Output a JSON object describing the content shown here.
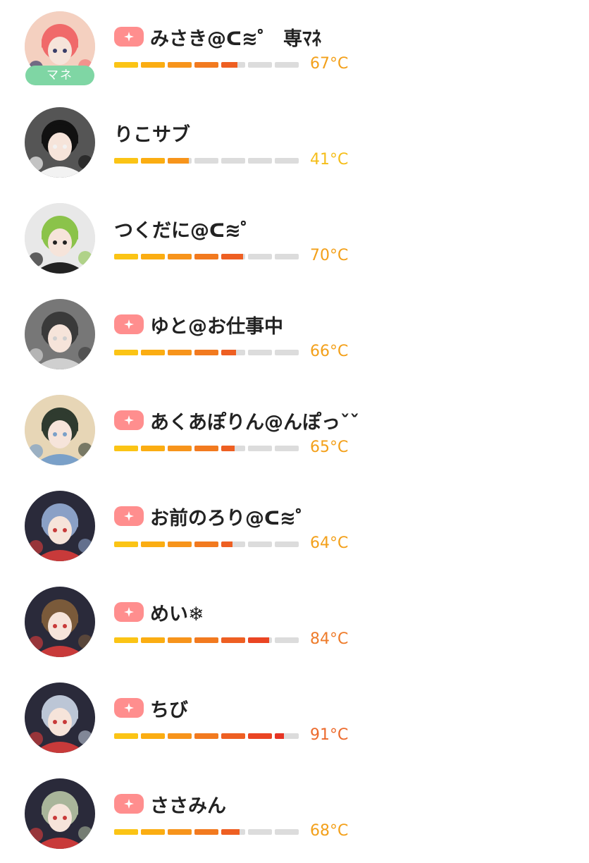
{
  "users": [
    {
      "name": "みさき@ᑕ≋゜ 専ﾏﾈ",
      "has_badge": true,
      "role": "マネ",
      "temperature": "67°C",
      "level": 67,
      "temp_color": "#f3a01a",
      "avatar_colors": [
        "#f06a6a",
        "#3a3f6a",
        "#f4d0c0"
      ]
    },
    {
      "name": "りこサブ",
      "has_badge": false,
      "role": "",
      "temperature": "41°C",
      "level": 41,
      "temp_color": "#f5be1a",
      "avatar_colors": [
        "#111111",
        "#f2f2f2",
        "#555555"
      ]
    },
    {
      "name": "つくだに@ᑕ≋゜",
      "has_badge": false,
      "role": "",
      "temperature": "70°C",
      "level": 70,
      "temp_color": "#f3a01a",
      "avatar_colors": [
        "#8bc34a",
        "#222222",
        "#e8e8e8"
      ]
    },
    {
      "name": "ゆと@お仕事中",
      "has_badge": true,
      "role": "",
      "temperature": "66°C",
      "level": 66,
      "temp_color": "#f3a01a",
      "avatar_colors": [
        "#3a3a3a",
        "#cfcfcf",
        "#777777"
      ]
    },
    {
      "name": "あくあぽりん@んぽっˇˇ",
      "has_badge": true,
      "role": "",
      "temperature": "65°C",
      "level": 65,
      "temp_color": "#f3a01a",
      "avatar_colors": [
        "#2f3b2f",
        "#7aa0c8",
        "#e7d6b6"
      ]
    },
    {
      "name": "お前のろり@ᑕ≋゜",
      "has_badge": true,
      "role": "",
      "temperature": "64°C",
      "level": 64,
      "temp_color": "#f3a01a",
      "avatar_colors": [
        "#8aa0c6",
        "#c83a3a",
        "#2a2a3a"
      ]
    },
    {
      "name": "めい❄︎",
      "has_badge": true,
      "role": "",
      "temperature": "84°C",
      "level": 84,
      "temp_color": "#ee7b2a",
      "avatar_colors": [
        "#7a5a3a",
        "#c83a3a",
        "#2a2a3a"
      ]
    },
    {
      "name": "ちび",
      "has_badge": true,
      "role": "",
      "temperature": "91°C",
      "level": 91,
      "temp_color": "#ec6a2c",
      "avatar_colors": [
        "#bcc6d6",
        "#c83a3a",
        "#2a2a3a"
      ]
    },
    {
      "name": "ささみん",
      "has_badge": true,
      "role": "",
      "temperature": "68°C",
      "level": 68,
      "temp_color": "#f3a01a",
      "avatar_colors": [
        "#a9b59a",
        "#c83a3a",
        "#2a2a3a"
      ]
    }
  ],
  "icons": {
    "badge": "sparkle-icon",
    "avatar": "user-avatar-image"
  },
  "meter_colors": [
    "#fbc415",
    "#fbad12",
    "#f7941b",
    "#f27a1f",
    "#ee5f22",
    "#ea4523",
    "#e63424"
  ]
}
